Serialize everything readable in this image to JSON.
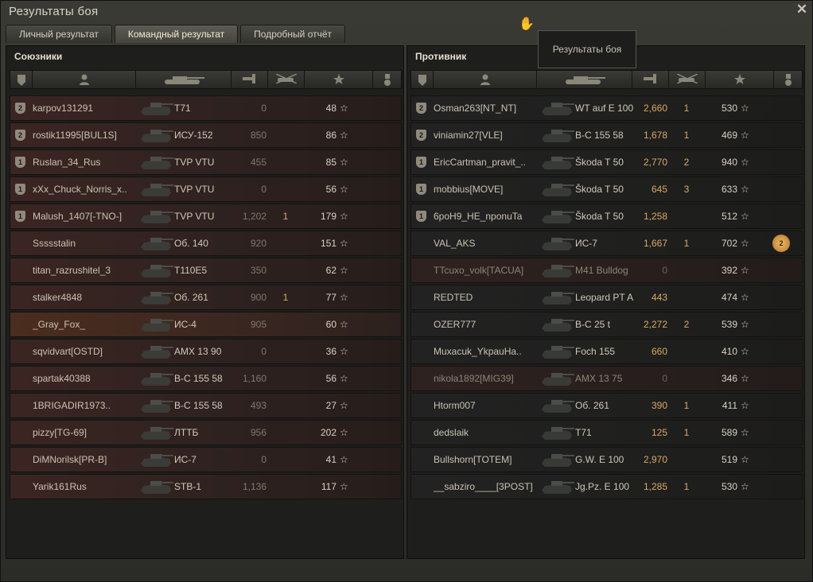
{
  "window": {
    "title": "Результаты боя",
    "close_icon": "close-icon"
  },
  "tabs": [
    {
      "label": "Личный результат",
      "active": false
    },
    {
      "label": "Командный результат",
      "active": true
    },
    {
      "label": "Подробный отчёт",
      "active": false
    }
  ],
  "tooltip": {
    "text": "Результаты боя"
  },
  "allies": {
    "title": "Союзники",
    "rows": [
      {
        "badge": "2",
        "name": "karpov131291",
        "tank": "T71",
        "damage": "0",
        "frags": "",
        "xp": "48",
        "dead": false
      },
      {
        "badge": "2",
        "name": "rostik11995[BUL1S]",
        "tank": "ИСУ-152",
        "damage": "850",
        "frags": "",
        "xp": "86",
        "dead": false
      },
      {
        "badge": "1",
        "name": "Ruslan_34_Rus",
        "tank": "TVP VTU",
        "damage": "455",
        "frags": "",
        "xp": "85",
        "dead": false
      },
      {
        "badge": "1",
        "name": "xXx_Chuck_Norris_x..",
        "tank": "TVP VTU",
        "damage": "0",
        "frags": "",
        "xp": "56",
        "dead": false
      },
      {
        "badge": "1",
        "name": "Malush_1407[-TNO-]",
        "tank": "TVP VTU",
        "damage": "1,202",
        "frags": "1",
        "xp": "179",
        "dead": false
      },
      {
        "badge": "",
        "name": "Ssssstalin",
        "tank": "Об. 140",
        "damage": "920",
        "frags": "",
        "xp": "151",
        "dead": false
      },
      {
        "badge": "",
        "name": "titan_razrushitel_3",
        "tank": "T110E5",
        "damage": "350",
        "frags": "",
        "xp": "62",
        "dead": false
      },
      {
        "badge": "",
        "name": "stalker4848",
        "tank": "Об. 261",
        "damage": "900",
        "frags": "1",
        "xp": "77",
        "dead": false
      },
      {
        "badge": "",
        "name": "_Gray_Fox_",
        "tank": "ИС-4",
        "damage": "905",
        "frags": "",
        "xp": "60",
        "dead": false,
        "highlight": true
      },
      {
        "badge": "",
        "name": "sqvidvart[OSTD]",
        "tank": "AMX 13 90",
        "damage": "0",
        "frags": "",
        "xp": "36",
        "dead": false
      },
      {
        "badge": "",
        "name": "spartak40388",
        "tank": "B-C 155 58",
        "damage": "1,160",
        "frags": "",
        "xp": "56",
        "dead": false
      },
      {
        "badge": "",
        "name": "1BRIGADIR1973..",
        "tank": "B-C 155 58",
        "damage": "493",
        "frags": "",
        "xp": "27",
        "dead": false
      },
      {
        "badge": "",
        "name": "pizzy[TG-69]",
        "tank": "ЛТТБ",
        "damage": "956",
        "frags": "",
        "xp": "202",
        "dead": false
      },
      {
        "badge": "",
        "name": "DiMNorilsk[PR-B]",
        "tank": "ИС-7",
        "damage": "0",
        "frags": "",
        "xp": "41",
        "dead": false
      },
      {
        "badge": "",
        "name": "Yarik161Rus",
        "tank": "STB-1",
        "damage": "1,136",
        "frags": "",
        "xp": "117",
        "dead": false
      }
    ]
  },
  "enemies": {
    "title": "Противник",
    "rows": [
      {
        "badge": "2",
        "name": "Osman263[NT_NT]",
        "tank": "WT auf E 100",
        "damage": "2,660",
        "frags": "1",
        "xp": "530",
        "dead": false
      },
      {
        "badge": "2",
        "name": "viniamin27[VLE]",
        "tank": "B-C 155 58",
        "damage": "1,678",
        "frags": "1",
        "xp": "469",
        "dead": false
      },
      {
        "badge": "1",
        "name": "EricCartman_pravit_..",
        "tank": "Škoda T 50",
        "damage": "2,770",
        "frags": "2",
        "xp": "940",
        "dead": false
      },
      {
        "badge": "1",
        "name": "mobbius[MOVE]",
        "tank": "Škoda T 50",
        "damage": "645",
        "frags": "3",
        "xp": "633",
        "dead": false
      },
      {
        "badge": "1",
        "name": "6poH9_HE_nponuTa",
        "tank": "Škoda T 50",
        "damage": "1,258",
        "frags": "",
        "xp": "512",
        "dead": false
      },
      {
        "badge": "",
        "name": "VAL_AKS",
        "tank": "ИС-7",
        "damage": "1,667",
        "frags": "1",
        "xp": "702",
        "dead": false,
        "medal": "2"
      },
      {
        "badge": "",
        "name": "TTcuxo_volk[TACUA]",
        "tank": "M41 Bulldog",
        "damage": "0",
        "frags": "",
        "xp": "392",
        "dead": true
      },
      {
        "badge": "",
        "name": "REDTED",
        "tank": "Leopard PT A",
        "damage": "443",
        "frags": "",
        "xp": "474",
        "dead": false
      },
      {
        "badge": "",
        "name": "OZER777",
        "tank": "B-C 25 t",
        "damage": "2,272",
        "frags": "2",
        "xp": "539",
        "dead": false
      },
      {
        "badge": "",
        "name": "Muxacuk_YkpauHa..",
        "tank": "Foch 155",
        "damage": "660",
        "frags": "",
        "xp": "410",
        "dead": false
      },
      {
        "badge": "",
        "name": "nikola1892[MIG39]",
        "tank": "AMX 13 75",
        "damage": "0",
        "frags": "",
        "xp": "346",
        "dead": true
      },
      {
        "badge": "",
        "name": "Htorm007",
        "tank": "Об. 261",
        "damage": "390",
        "frags": "1",
        "xp": "411",
        "dead": false
      },
      {
        "badge": "",
        "name": "dedslaik",
        "tank": "T71",
        "damage": "125",
        "frags": "1",
        "xp": "589",
        "dead": false
      },
      {
        "badge": "",
        "name": "Bullshorn[TOTEM]",
        "tank": "G.W. E 100",
        "damage": "2,970",
        "frags": "",
        "xp": "519",
        "dead": false
      },
      {
        "badge": "",
        "name": "__sabziro____[3POST]",
        "tank": "Jg.Pz. E 100",
        "damage": "1,285",
        "frags": "1",
        "xp": "530",
        "dead": false
      }
    ]
  },
  "columns": [
    "squad-icon",
    "player-icon",
    "tank-icon",
    "damage-icon",
    "frags-icon",
    "xp-star-icon",
    "medal-icon"
  ],
  "colors": {
    "damage": "#d9a961",
    "ally_row": "#3b2522",
    "enemy_row": "#222222"
  }
}
